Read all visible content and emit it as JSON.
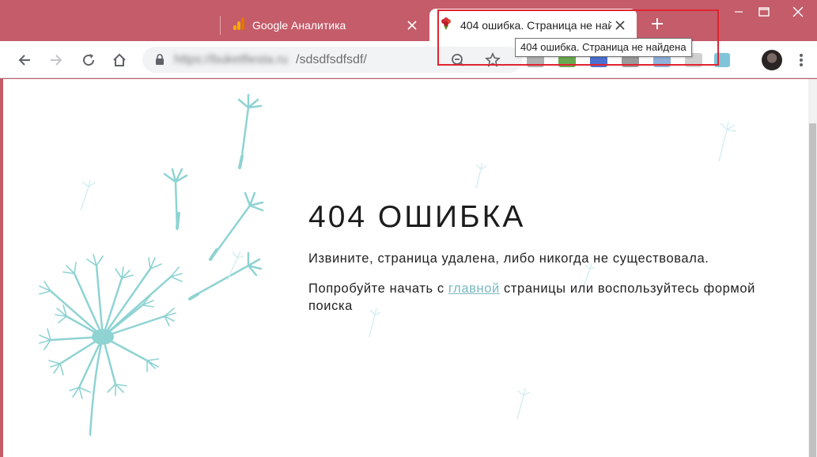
{
  "tabs": [
    {
      "title": "Google Аналитика",
      "icon": "analytics-icon",
      "active": false
    },
    {
      "title": "404 ошибка. Страница не найдена",
      "icon": "flower-favicon-icon",
      "active": true
    }
  ],
  "tooltip": "404 ошибка. Страница не найдена",
  "address_bar": {
    "host": "https://buketfiesta.ru",
    "path": "/sdsdfsdfsdf/"
  },
  "page": {
    "heading": "404 ОШИБКА",
    "message": "Извините, страница удалена, либо никогда не существовала.",
    "suggestion_before": "Попробуйте начать с ",
    "suggestion_link": "главной",
    "suggestion_after": " страницы или воспользуйтесь формой поиска"
  },
  "colors": {
    "frame": "#c45c6a",
    "accent": "#8fd3d3",
    "link": "#7ab8c2",
    "highlight": "#e0242e"
  }
}
